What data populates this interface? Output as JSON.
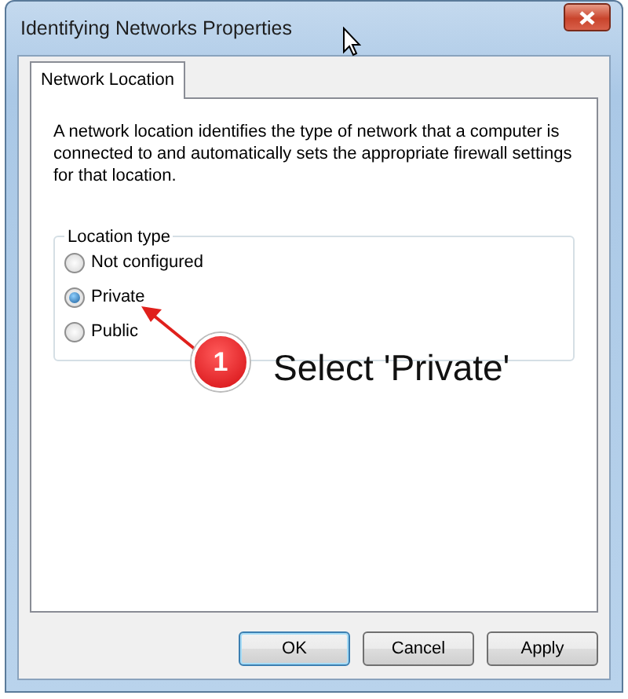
{
  "window": {
    "title": "Identifying Networks Properties"
  },
  "tabs": [
    {
      "label": "Network Location",
      "selected": true
    }
  ],
  "description": "A network location identifies the type of network that a computer is connected to and automatically sets the appropriate firewall settings for that location.",
  "location_type": {
    "legend": "Location type",
    "options": [
      {
        "label": "Not configured",
        "selected": false
      },
      {
        "label": "Private",
        "selected": true
      },
      {
        "label": "Public",
        "selected": false
      }
    ]
  },
  "annotation": {
    "number": "1",
    "text": "Select 'Private'"
  },
  "buttons": [
    {
      "label": "OK",
      "default": true
    },
    {
      "label": "Cancel",
      "default": false
    },
    {
      "label": "Apply",
      "default": false
    }
  ]
}
